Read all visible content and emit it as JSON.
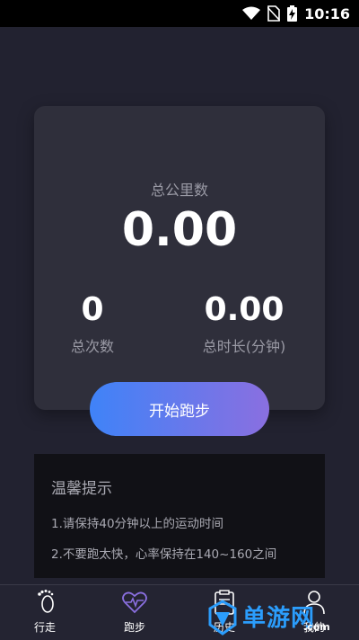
{
  "status_bar": {
    "time": "10:16"
  },
  "stats": {
    "total_km_label": "总公里数",
    "total_km_value": "0.00",
    "total_count_value": "0",
    "total_count_label": "总次数",
    "total_duration_value": "0.00",
    "total_duration_label": "总时长(分钟)"
  },
  "start_button_label": "开始跑步",
  "tips": {
    "title": "温馨提示",
    "items": [
      "1.请保持40分钟以上的运动时间",
      "2.不要跑太快，心率保持在140~160之间"
    ]
  },
  "tabs": [
    {
      "label": "行走",
      "icon": "footprint-icon",
      "active": false
    },
    {
      "label": "跑步",
      "icon": "heart-pulse-icon",
      "active": true
    },
    {
      "label": "历史",
      "icon": "clipboard-icon",
      "active": false
    },
    {
      "label": "我的",
      "icon": "user-icon",
      "active": false
    }
  ],
  "watermark": {
    "text": "单游网",
    "domain": ".com"
  },
  "colors": {
    "background": "#222230",
    "card": "#2f2f3b",
    "button_gradient_start": "#3f83f8",
    "button_gradient_end": "#8a6fe0",
    "active_tab_icon": "#8a6fe0",
    "watermark": "#2b9dfc"
  }
}
